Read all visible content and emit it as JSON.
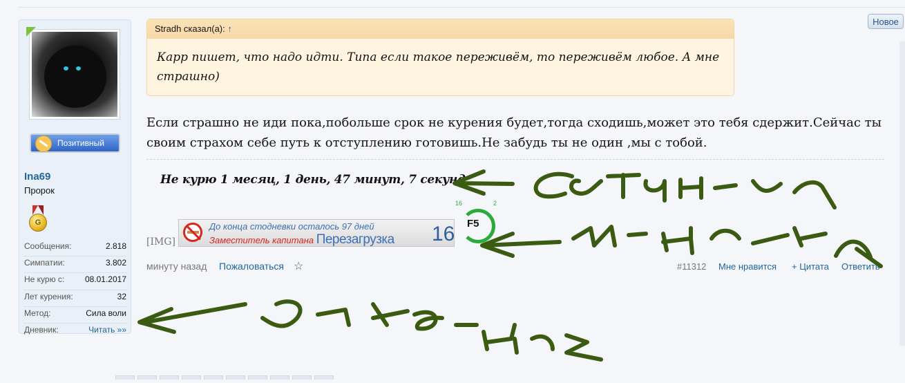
{
  "header": {
    "new_button": "Новое"
  },
  "sidebar": {
    "badge_label": "Позитивный",
    "username": "Ina69",
    "user_title": "Пророк",
    "medal_letter": "G",
    "stats": [
      {
        "label": "Сообщения:",
        "value": "2.818"
      },
      {
        "label": "Симпатии:",
        "value": "3.802"
      },
      {
        "label": "Не курю с:",
        "value": "08.01.2017"
      },
      {
        "label": "Лет курения:",
        "value": "32"
      },
      {
        "label": "Метод:",
        "value": "Сила воли"
      },
      {
        "label": "Дневник:",
        "value": "Читать »»"
      }
    ]
  },
  "quote": {
    "author": "Stradh сказал(а):",
    "arrow": "↑",
    "text": "Карр пишет, что надо идти. Типа если такое переживём, то переживём любое. А мне страшно)"
  },
  "post": {
    "text": "Если страшно не иди пока,побольше срок не курения будет,тогда сходишь,может это тебя сдержит.Сейчас ты своим страхом себе путь к отступлению готовишь.Не забудь ты не один ,мы с тобой."
  },
  "signature": {
    "counter": "Не курю 1 месяц, 1 день, 47 минут, 7 секунд",
    "img_tag": "[IMG]",
    "banner_line1": "До конца стодневки осталось 97 дней",
    "banner_line2_prefix": "Заместитель капитана",
    "banner_line2_name": "Перезагрузка",
    "banner_number": "16",
    "f5_label": "F5",
    "f5_small_left": "16",
    "f5_small_right": "2"
  },
  "footer": {
    "time": "минуту назад",
    "report": "Пожаловаться",
    "star": "☆",
    "post_number": "#11312",
    "like": "Мне нравится",
    "quote": "+ Цитата",
    "reply": "Ответить"
  },
  "colors": {
    "link": "#22669a",
    "quote_bg": "#fff4e0",
    "scribble": "#3b5a12"
  }
}
